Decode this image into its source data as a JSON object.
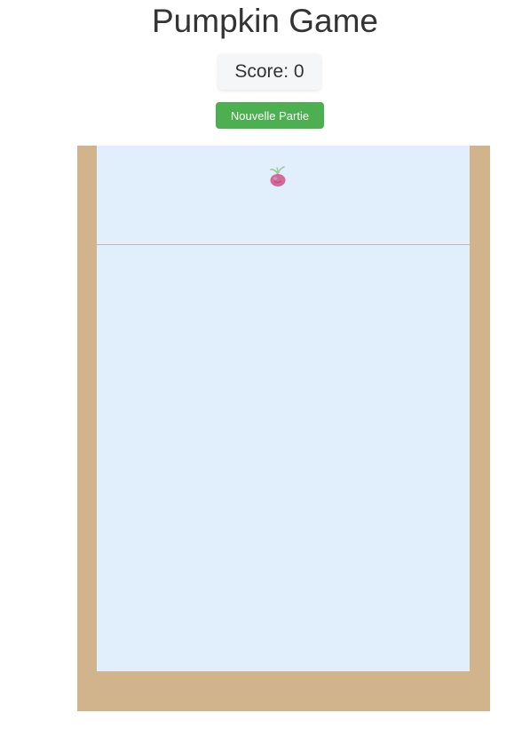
{
  "game": {
    "title": "Pumpkin Game",
    "score_label": "Score:",
    "score_value": "0",
    "new_game_label": "Nouvelle Partie"
  },
  "board": {
    "current_fruit": "radish-icon"
  },
  "colors": {
    "button": "#4caf50",
    "board_frame": "#d2b48c",
    "play_area": "#e1effd",
    "title_text": "#333333"
  }
}
